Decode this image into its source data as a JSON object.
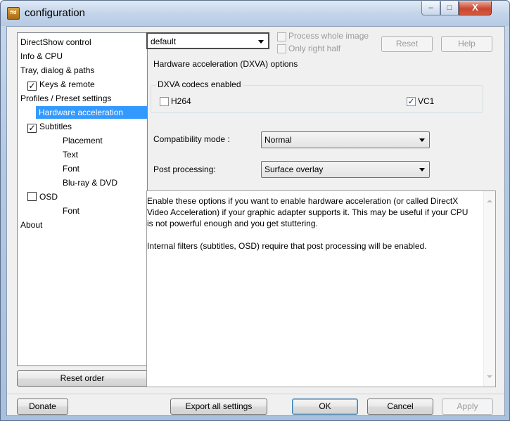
{
  "window": {
    "title": "configuration",
    "icon_text": "ffd",
    "controls": {
      "minimize": "–",
      "maximize": "□",
      "close": "X"
    }
  },
  "tree": {
    "items": [
      {
        "label": "DirectShow control",
        "indent": 0,
        "checkbox": null,
        "selected": false
      },
      {
        "label": "Info & CPU",
        "indent": 0,
        "checkbox": null,
        "selected": false
      },
      {
        "label": "Tray, dialog & paths",
        "indent": 0,
        "checkbox": null,
        "selected": false
      },
      {
        "label": "Keys & remote",
        "indent": 1,
        "checkbox": true,
        "selected": false
      },
      {
        "label": "Profiles / Preset settings",
        "indent": 0,
        "checkbox": null,
        "selected": false
      },
      {
        "label": "Hardware acceleration",
        "indent": 2,
        "checkbox": null,
        "selected": true
      },
      {
        "label": "Subtitles",
        "indent": 1,
        "checkbox": true,
        "selected": false
      },
      {
        "label": "Placement",
        "indent": 3,
        "checkbox": null,
        "selected": false
      },
      {
        "label": "Text",
        "indent": 3,
        "checkbox": null,
        "selected": false
      },
      {
        "label": "Font",
        "indent": 3,
        "checkbox": null,
        "selected": false
      },
      {
        "label": "Blu-ray & DVD",
        "indent": 3,
        "checkbox": null,
        "selected": false
      },
      {
        "label": "OSD",
        "indent": 1,
        "checkbox": false,
        "selected": false
      },
      {
        "label": "Font",
        "indent": 3,
        "checkbox": null,
        "selected": false
      },
      {
        "label": "About",
        "indent": 0,
        "checkbox": null,
        "selected": false
      }
    ],
    "reset_order_label": "Reset order"
  },
  "toolbar": {
    "profile_value": "default",
    "process_whole_image": "Process whole image",
    "only_right_half": "Only right half",
    "reset_label": "Reset",
    "help_label": "Help"
  },
  "dxva": {
    "section_title": "Hardware acceleration (DXVA) options",
    "codecs_group_title": "DXVA codecs enabled",
    "h264_label": "H264",
    "h264_checked": false,
    "vc1_label": "VC1",
    "vc1_checked": true,
    "compat_label": "Compatibility mode :",
    "compat_value": "Normal",
    "post_label": "Post processing:",
    "post_value": "Surface overlay"
  },
  "info": {
    "paragraph1": "Enable these options if you want to enable hardware acceleration (or called DirectX Video Acceleration) if your graphic adapter supports it. This may be useful if your CPU is not powerful enough and you get stuttering.",
    "paragraph2": "Internal filters (subtitles, OSD) require that post processing will be enabled."
  },
  "footer": {
    "donate_label": "Donate",
    "export_label": "Export all settings",
    "ok_label": "OK",
    "cancel_label": "Cancel",
    "apply_label": "Apply"
  }
}
